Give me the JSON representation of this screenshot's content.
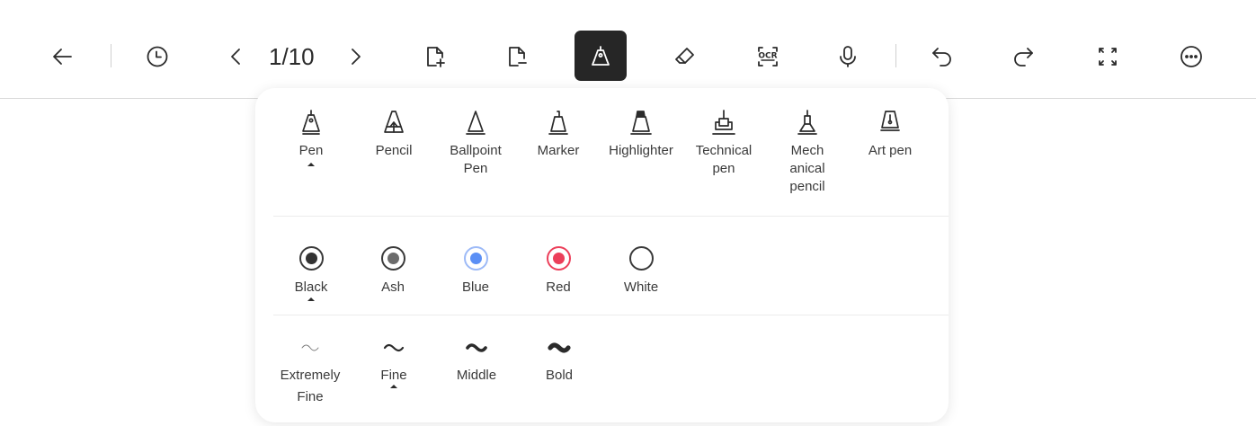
{
  "toolbar": {
    "page_indicator": "1/10",
    "ocr_label": "OCR",
    "active_tool": "pen"
  },
  "pen_panel": {
    "pen_types": [
      {
        "label": "Pen",
        "icon": "pen-icon",
        "selected": true
      },
      {
        "label": "Pencil",
        "icon": "pencil-icon",
        "selected": false
      },
      {
        "label": "Ballpoint\nPen",
        "icon": "ballpoint-pen-icon",
        "selected": false
      },
      {
        "label": "Marker",
        "icon": "marker-icon",
        "selected": false
      },
      {
        "label": "Highlighter",
        "icon": "highlighter-icon",
        "selected": false
      },
      {
        "label": "Technical\npen",
        "icon": "technical-pen-icon",
        "selected": false
      },
      {
        "label": "Mech\nanical\npencil",
        "icon": "mechanical-pencil-icon",
        "selected": false
      },
      {
        "label": "Art pen",
        "icon": "art-pen-icon",
        "selected": false
      }
    ],
    "colors": [
      {
        "label": "Black",
        "hex": "#333333",
        "selected": true
      },
      {
        "label": "Ash",
        "hex": "#6b6b6b",
        "selected": false
      },
      {
        "label": "Blue",
        "hex": "#5b8ff5",
        "selected": false
      },
      {
        "label": "Red",
        "hex": "#ec3f5a",
        "selected": false
      },
      {
        "label": "White",
        "hex": "#ffffff",
        "selected": false
      }
    ],
    "stroke_widths": [
      {
        "label": "Extremely\nFine",
        "selected": false
      },
      {
        "label": "Fine",
        "selected": true
      },
      {
        "label": "Middle",
        "selected": false
      },
      {
        "label": "Bold",
        "selected": false
      }
    ]
  }
}
